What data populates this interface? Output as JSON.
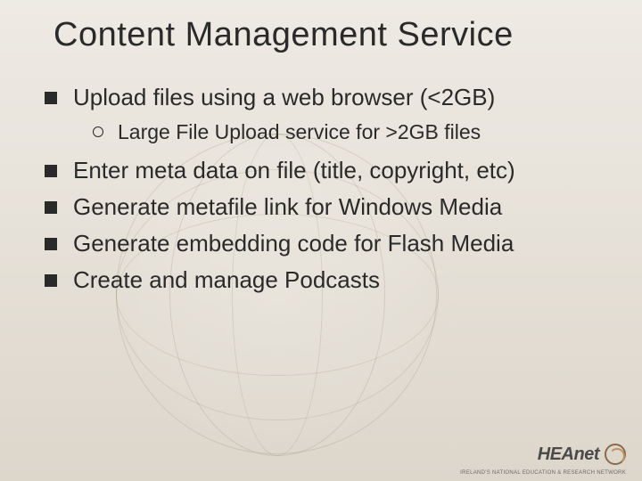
{
  "title": "Content Management Service",
  "bullets": [
    {
      "text": "Upload files using a web browser (<2GB)",
      "sub": [
        {
          "text": "Large File Upload service for >2GB files"
        }
      ]
    },
    {
      "text": "Enter meta data on file (title, copyright, etc)"
    },
    {
      "text": "Generate metafile link for Windows Media"
    },
    {
      "text": "Generate embedding code for Flash Media"
    },
    {
      "text": "Create and manage Podcasts"
    }
  ],
  "logo": {
    "name": "HEAnet",
    "tagline": "IRELAND'S NATIONAL EDUCATION & RESEARCH NETWORK"
  }
}
